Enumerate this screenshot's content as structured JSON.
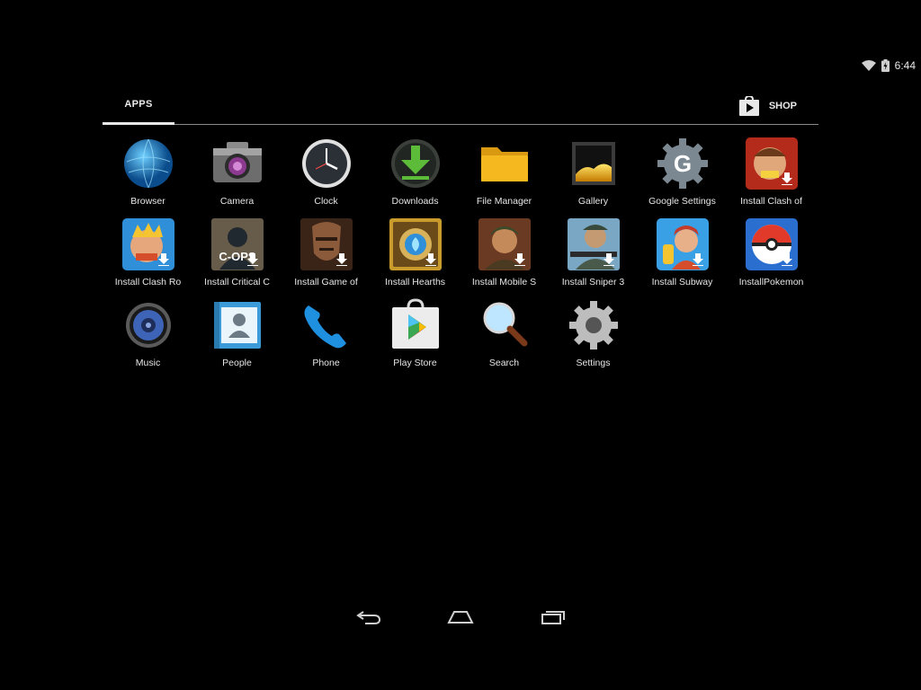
{
  "status": {
    "time": "6:44"
  },
  "tabs": {
    "apps": "APPS",
    "shop": "SHOP"
  },
  "apps": [
    {
      "label": "Browser",
      "icon": "browser-icon"
    },
    {
      "label": "Camera",
      "icon": "camera-icon"
    },
    {
      "label": "Clock",
      "icon": "clock-icon"
    },
    {
      "label": "Downloads",
      "icon": "downloads-icon"
    },
    {
      "label": "File Manager",
      "icon": "folder-icon"
    },
    {
      "label": "Gallery",
      "icon": "gallery-icon"
    },
    {
      "label": "Google Settings",
      "icon": "google-settings-icon"
    },
    {
      "label": "Install Clash of",
      "icon": "clash-of-clans-icon"
    },
    {
      "label": "Install Clash Ro",
      "icon": "clash-royale-icon"
    },
    {
      "label": "Install Critical C",
      "icon": "critical-ops-icon"
    },
    {
      "label": "Install Game of",
      "icon": "game-of-war-icon"
    },
    {
      "label": "Install Hearths",
      "icon": "hearthstone-icon"
    },
    {
      "label": "Install Mobile S",
      "icon": "mobile-strike-icon"
    },
    {
      "label": "Install Sniper 3",
      "icon": "sniper-icon"
    },
    {
      "label": "Install Subway",
      "icon": "subway-surfers-icon"
    },
    {
      "label": "InstallPokemon",
      "icon": "pokeball-icon"
    },
    {
      "label": "Music",
      "icon": "music-speaker-icon"
    },
    {
      "label": "People",
      "icon": "contacts-icon"
    },
    {
      "label": "Phone",
      "icon": "phone-icon"
    },
    {
      "label": "Play Store",
      "icon": "play-store-icon"
    },
    {
      "label": "Search",
      "icon": "search-icon"
    },
    {
      "label": "Settings",
      "icon": "gear-icon"
    }
  ],
  "colors": {
    "background": "#000000",
    "text": "#e6e6e6",
    "divider": "#8a8a8a"
  }
}
